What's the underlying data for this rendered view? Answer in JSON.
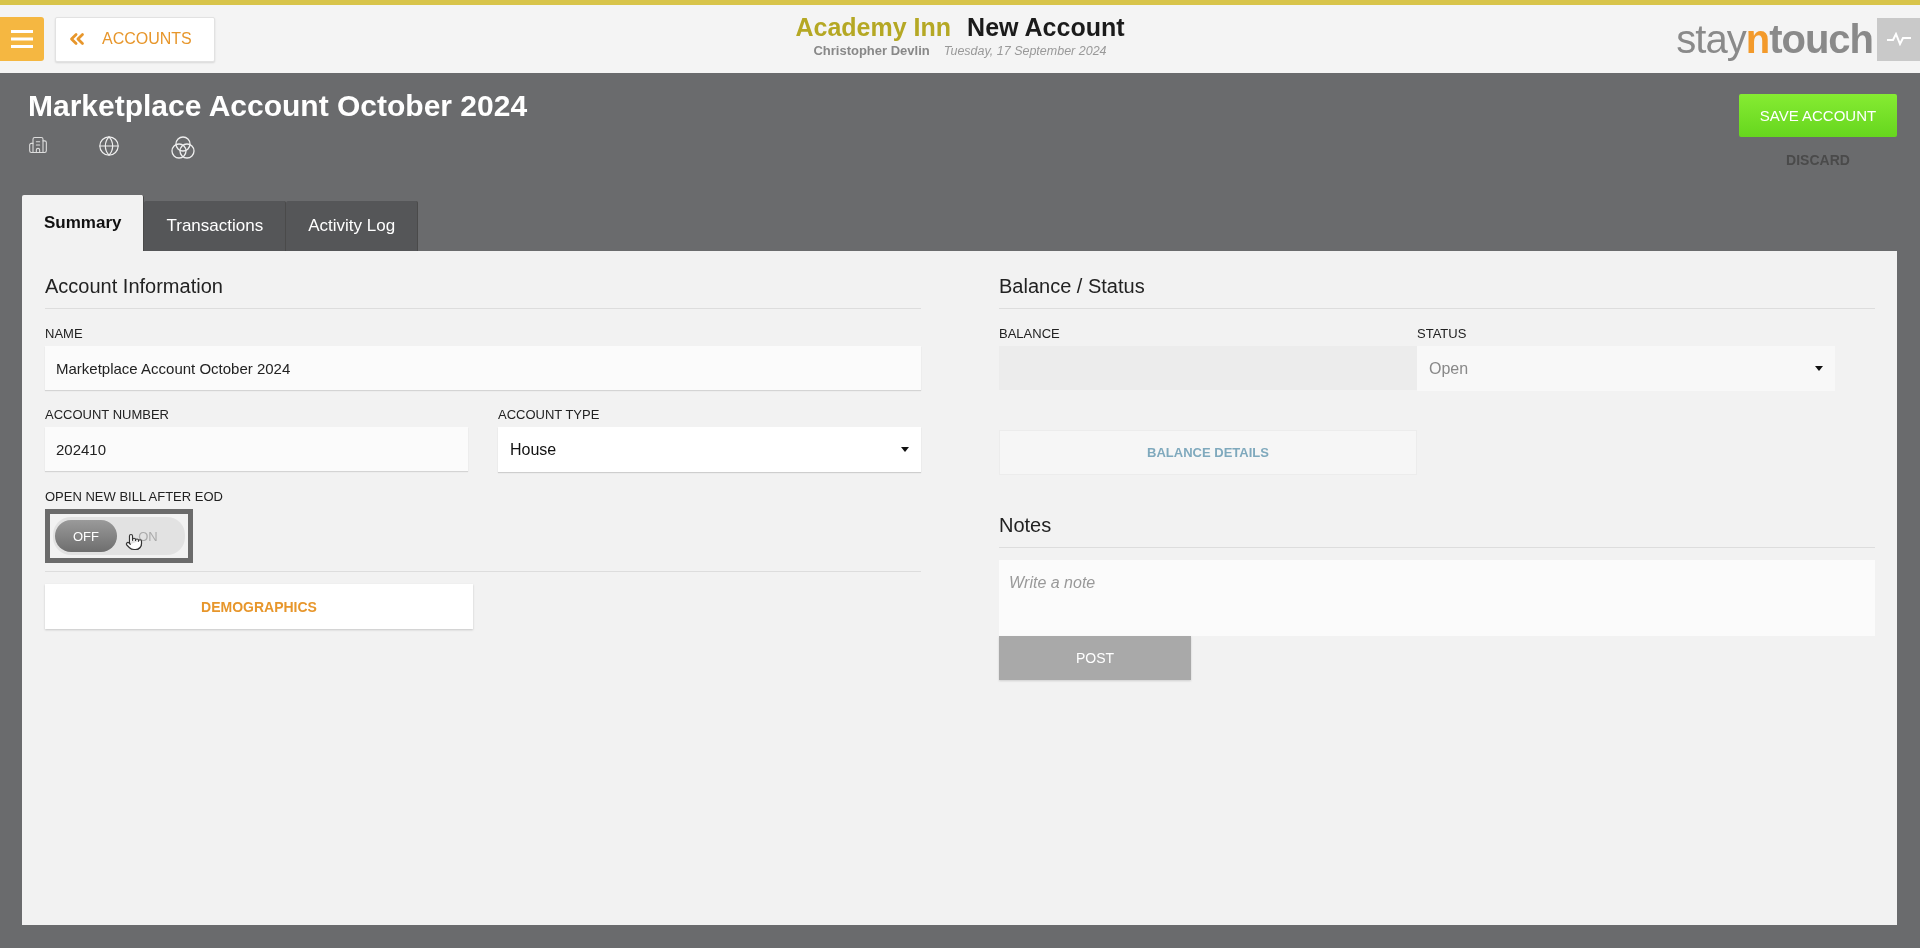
{
  "header": {
    "back_button": "ACCOUNTS",
    "hotel": "Academy Inn",
    "page": "New Account",
    "user": "Christopher Devlin",
    "date": "Tuesday, 17 September 2024",
    "logo": [
      {
        "text": "stay",
        "kind": "plain"
      },
      {
        "text": "n",
        "kind": "accent"
      },
      {
        "text": "touch",
        "kind": "plain"
      }
    ]
  },
  "account": {
    "title": "Marketplace Account October 2024",
    "save_button": "SAVE ACCOUNT",
    "discard_button": "DISCARD"
  },
  "tabs": [
    {
      "label": "Summary",
      "selected": true
    },
    {
      "label": "Transactions",
      "selected": false
    },
    {
      "label": "Activity Log",
      "selected": false
    }
  ],
  "account_information": {
    "heading": "Account Information",
    "name": {
      "label": "NAME",
      "value": "Marketplace Account October 2024"
    },
    "account_number": {
      "label": "ACCOUNT NUMBER",
      "value": "202410"
    },
    "account_type": {
      "label": "ACCOUNT TYPE",
      "value": "House"
    },
    "open_new_bill": {
      "label": "OPEN NEW BILL AFTER EOD",
      "on": false,
      "off_label": "OFF",
      "on_label": "ON"
    },
    "demographics_button": "DEMOGRAPHICS"
  },
  "balance_status": {
    "heading": "Balance / Status",
    "balance": {
      "label": "BALANCE",
      "disabled": true
    },
    "status": {
      "label": "STATUS",
      "value": "Open",
      "disabled": true
    },
    "balance_details_button": {
      "label": "BALANCE DETAILS",
      "disabled": true
    }
  },
  "notes": {
    "heading": "Notes",
    "placeholder": "Write a note",
    "post_button": {
      "label": "POST",
      "disabled": true
    }
  }
}
